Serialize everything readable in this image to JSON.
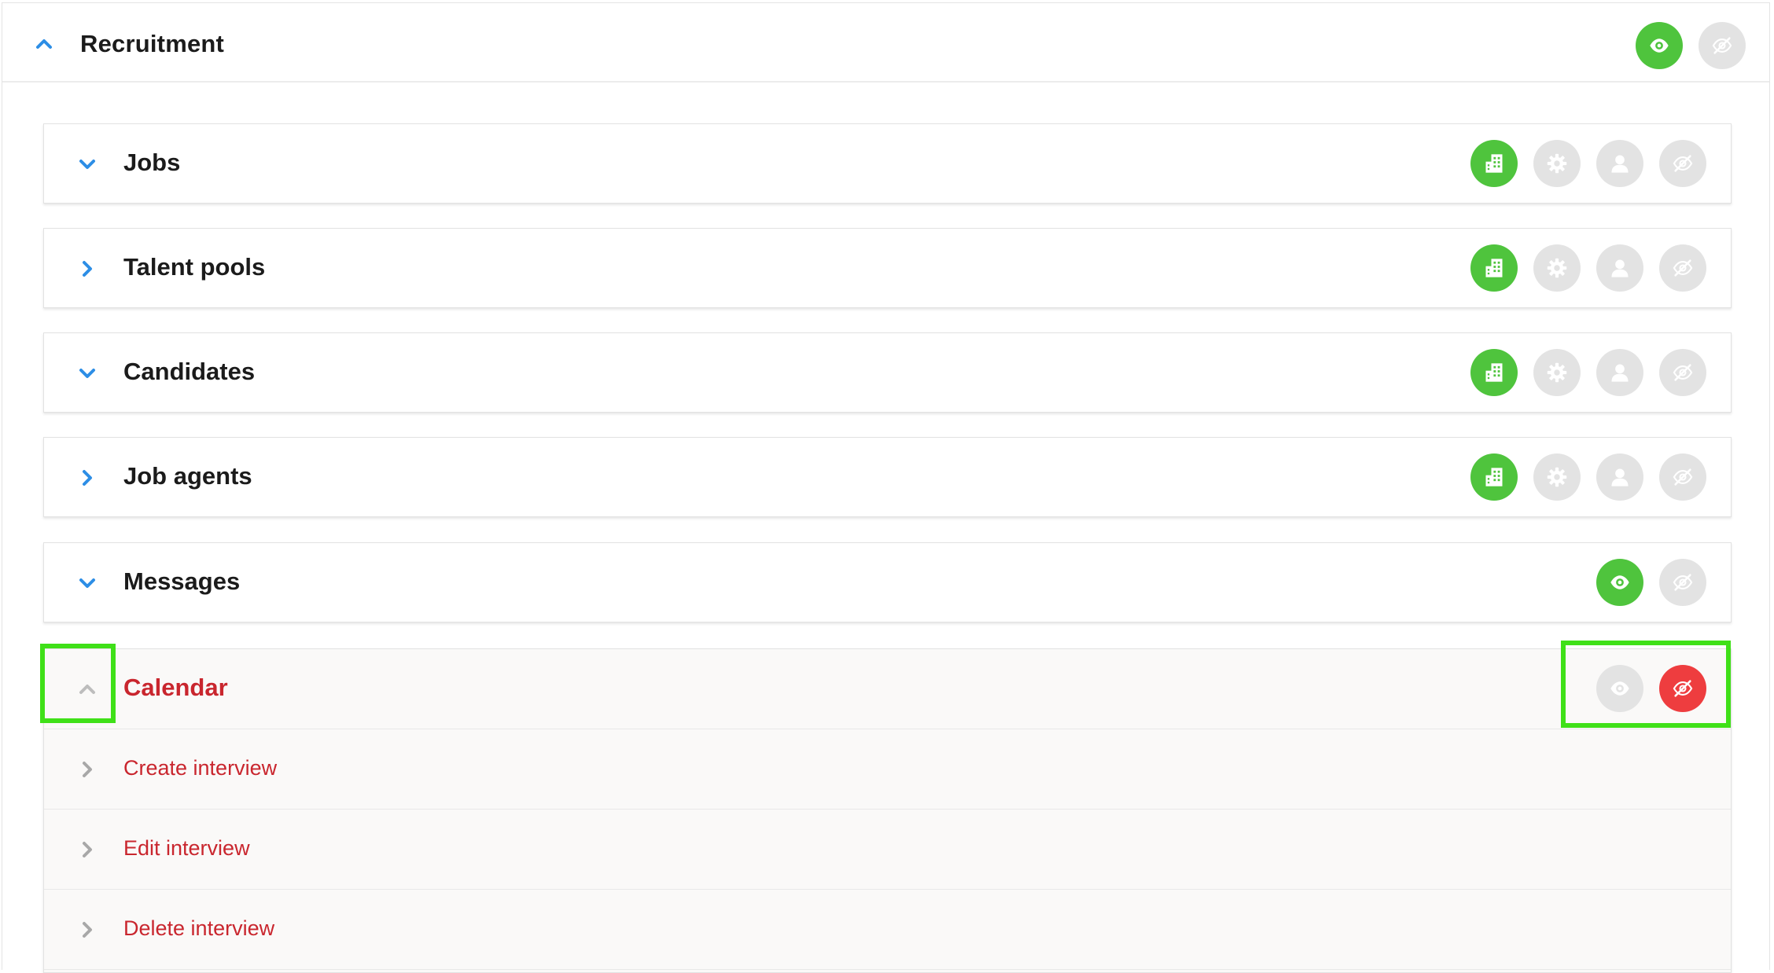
{
  "header": {
    "title": "Recruitment"
  },
  "sections": [
    {
      "title": "Jobs",
      "expanded": true
    },
    {
      "title": "Talent pools",
      "expanded": false
    },
    {
      "title": "Candidates",
      "expanded": true
    },
    {
      "title": "Job agents",
      "expanded": false
    },
    {
      "title": "Messages",
      "expanded": true
    }
  ],
  "calendar": {
    "title": "Calendar",
    "items": [
      {
        "label": "Create interview"
      },
      {
        "label": "Edit interview"
      },
      {
        "label": "Delete interview"
      }
    ]
  },
  "colors": {
    "accent_blue": "#2d8ee6",
    "active_green": "#4fc43d",
    "inactive_grey": "#e3e3e3",
    "denied_red": "#ee3d3f",
    "calendar_text": "#c9262e",
    "highlight": "#3fe018"
  },
  "icons": {
    "visible": "eye-icon",
    "hidden": "eye-slash-icon",
    "organization": "building-icon",
    "settings": "gear-icon",
    "own": "user-icon"
  }
}
